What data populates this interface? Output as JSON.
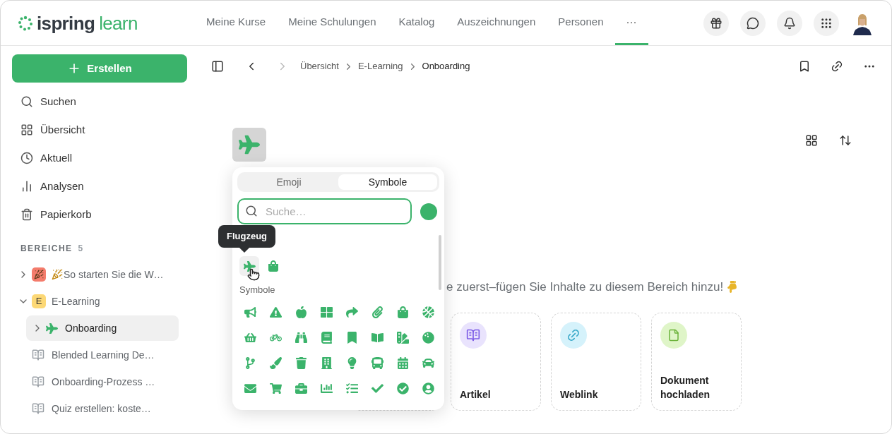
{
  "header": {
    "logo": {
      "part_1": "ispring",
      "part_2": "learn"
    },
    "nav": [
      {
        "label": "Meine Kurse",
        "selected": false
      },
      {
        "label": "Meine Schulungen",
        "selected": false
      },
      {
        "label": "Katalog",
        "selected": false
      },
      {
        "label": "Auszeichnungen",
        "selected": false
      },
      {
        "label": "Personen",
        "selected": false
      },
      {
        "label": "···",
        "selected": true
      }
    ]
  },
  "sidebar": {
    "create_button": "Erstellen",
    "menu": [
      {
        "label": "Suchen",
        "kind": "search"
      },
      {
        "label": "Übersicht",
        "kind": "overview"
      },
      {
        "label": "Aktuell",
        "kind": "recent"
      },
      {
        "label": "Analysen",
        "kind": "analytics"
      },
      {
        "label": "Papierkorb",
        "kind": "trash"
      }
    ],
    "spaces_heading": "BEREICHE",
    "spaces_count": "5",
    "tree": [
      {
        "label": "So starten Sie die W…",
        "kind": "space",
        "color": "#f47c6c",
        "expanded": false,
        "selected": false
      },
      {
        "label": "E-Learning",
        "kind": "space",
        "badge": "E",
        "color": "#fcd876",
        "expanded": true,
        "selected": false,
        "children": [
          {
            "label": "Onboarding",
            "kind": "symbol",
            "expanded": false,
            "selected": true
          },
          {
            "label": "Blended Learning De…",
            "kind": "article",
            "selected": false
          },
          {
            "label": "Onboarding-Prozess …",
            "kind": "article",
            "selected": false
          },
          {
            "label": "Quiz erstellen: koste…",
            "kind": "article",
            "selected": false
          }
        ]
      }
    ]
  },
  "breadcrumbs": [
    "Übersicht",
    "E-Learning",
    "Onboarding"
  ],
  "main": {
    "hint": "e zuerst–fügen Sie Inhalte zu diesem Bereich hinzu!",
    "cards": [
      {
        "label": "Artikel",
        "kind": "article",
        "color": "#e9e3fd"
      },
      {
        "label": "Weblink",
        "kind": "link",
        "color": "#d5f2fb"
      },
      {
        "label": "Dokument hochladen",
        "kind": "document",
        "color": "#dff5c8"
      }
    ]
  },
  "icon_picker": {
    "tabs": [
      {
        "label": "Emoji",
        "selected": false
      },
      {
        "label": "Symbole",
        "selected": true
      }
    ],
    "search": {
      "placeholder": "Suche…"
    },
    "color": "#3bb36b",
    "tooltip": "Flugzeug",
    "section_label": "Symbole"
  }
}
